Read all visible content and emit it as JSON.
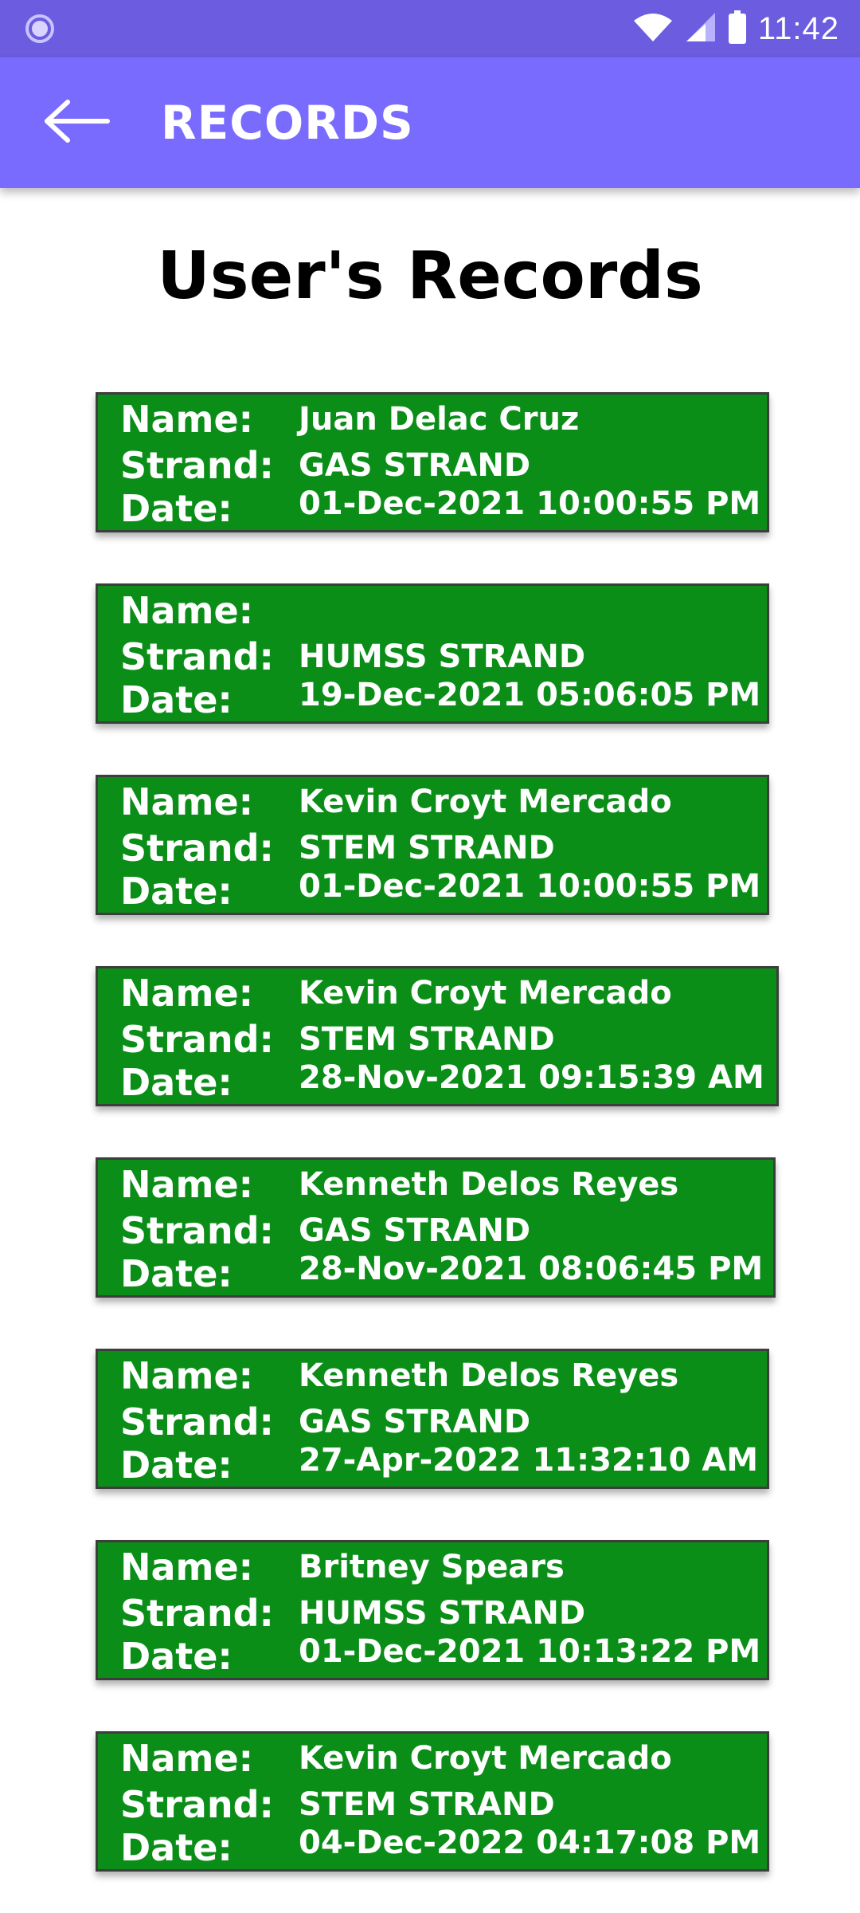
{
  "status_bar": {
    "time": "11:42",
    "icons": [
      "loading-icon",
      "wifi-icon",
      "signal-icon",
      "battery-icon"
    ]
  },
  "app_bar": {
    "title": "RECORDS",
    "back_icon": "arrow-left-icon"
  },
  "page": {
    "heading": "User's Records"
  },
  "labels": {
    "name": "Name:",
    "strand": "Strand:",
    "date": "Date:"
  },
  "records": [
    {
      "name": "Juan Delac Cruz",
      "strand": "GAS STRAND",
      "date": "01-Dec-2021 10:00:55 PM"
    },
    {
      "name": "",
      "strand": "HUMSS STRAND",
      "date": "19-Dec-2021 05:06:05 PM"
    },
    {
      "name": "Kevin Croyt Mercado",
      "strand": "STEM STRAND",
      "date": "01-Dec-2021 10:00:55 PM"
    },
    {
      "name": "Kevin Croyt Mercado",
      "strand": "STEM STRAND",
      "date": "28-Nov-2021 09:15:39 AM"
    },
    {
      "name": "Kenneth Delos Reyes",
      "strand": "GAS STRAND",
      "date": "28-Nov-2021 08:06:45 PM"
    },
    {
      "name": "Kenneth Delos Reyes",
      "strand": "GAS STRAND",
      "date": "27-Apr-2022 11:32:10 AM"
    },
    {
      "name": "Britney Spears",
      "strand": "HUMSS STRAND",
      "date": "01-Dec-2021 10:13:22 PM"
    },
    {
      "name": "Kevin Croyt Mercado",
      "strand": "STEM STRAND",
      "date": "04-Dec-2022 04:17:08 PM"
    }
  ],
  "colors": {
    "status_bar": "#6b5ce0",
    "app_bar": "#7a6bff",
    "card": "#0b8e18",
    "card_border": "#3d3d3d"
  }
}
